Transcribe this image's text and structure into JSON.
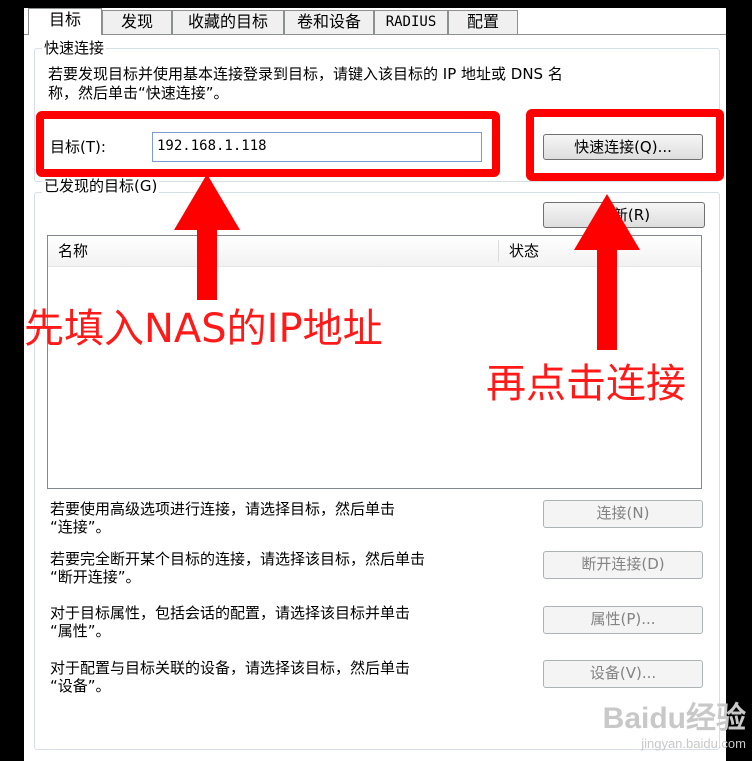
{
  "tabs": [
    "目标",
    "发现",
    "收藏的目标",
    "卷和设备",
    "RADIUS",
    "配置"
  ],
  "quick_connect": {
    "legend": "快速连接",
    "description_line1": "若要发现目标并使用基本连接登录到目标，请键入该目标的 IP 地址或 DNS 名",
    "description_line2": "称，然后单击“快速连接”。",
    "target_label": "目标(T):",
    "target_value": "192.168.1.118",
    "button_label": "快速连接(Q)..."
  },
  "discovered": {
    "legend": "已发现的目标(G)",
    "refresh_label": "刷新(R)",
    "columns": [
      "名称",
      "状态"
    ]
  },
  "actions": [
    {
      "line1": "若要使用高级选项进行连接，请选择目标，然后单击",
      "line2": "“连接”。",
      "button": "连接(N)"
    },
    {
      "line1": "若要完全断开某个目标的连接，请选择该目标，然后单击",
      "line2": "“断开连接”。",
      "button": "断开连接(D)"
    },
    {
      "line1": "对于目标属性，包括会话的配置，请选择该目标并单击",
      "line2": "“属性”。",
      "button": "属性(P)..."
    },
    {
      "line1": "对于配置与目标关联的设备，请选择该目标，然后单击",
      "line2": "“设备”。",
      "button": "设备(V)..."
    }
  ],
  "annotations": {
    "left": "先填入NAS的IP地址",
    "right": "再点击连接"
  },
  "watermark": {
    "brand": "Baidu经验",
    "url": "jingyan.baidu.com"
  },
  "colors": {
    "highlight_red": "#ff0000",
    "annotation_red": "#ff1a1a"
  }
}
